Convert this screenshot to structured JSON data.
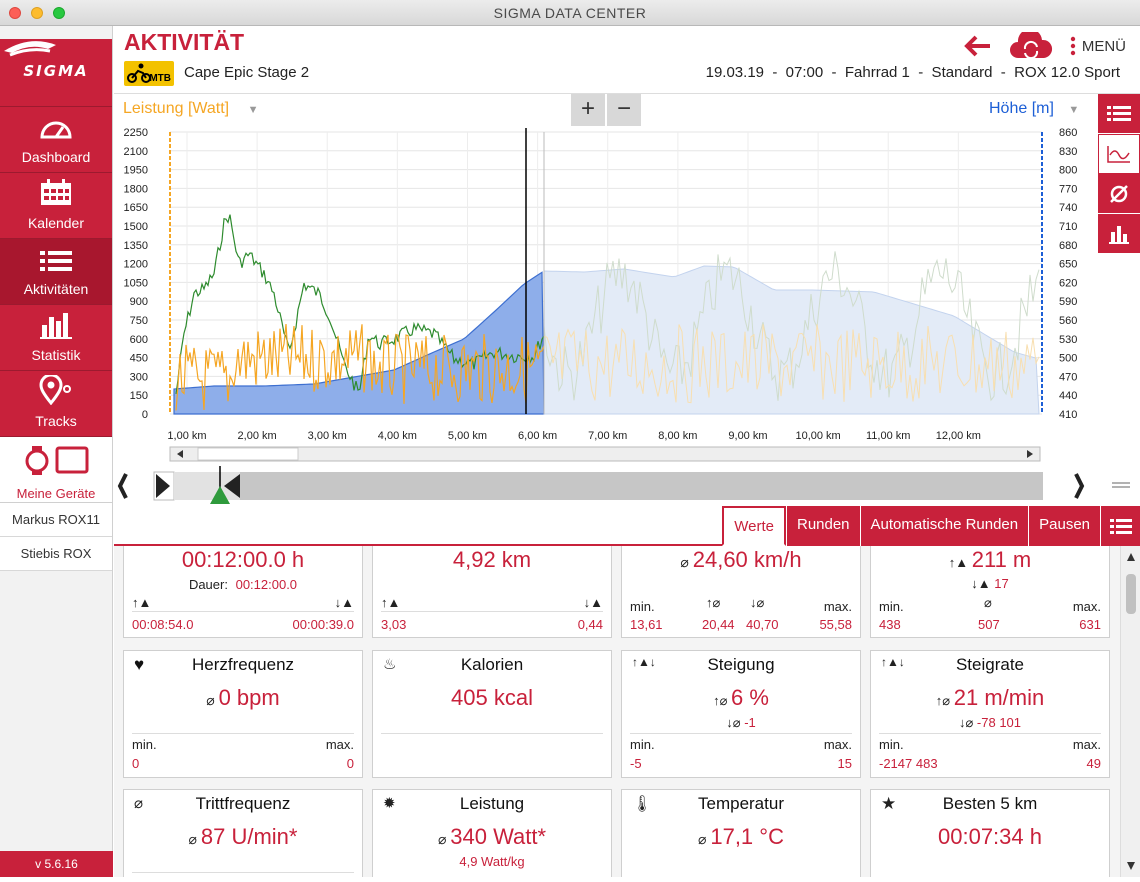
{
  "window": {
    "title": "SIGMA DATA CENTER"
  },
  "sidebar": {
    "brand": "SIGMA",
    "items": [
      {
        "label": "Dashboard",
        "icon": "speedometer-icon"
      },
      {
        "label": "Kalender",
        "icon": "calendar-icon"
      },
      {
        "label": "Aktivitäten",
        "icon": "list-icon"
      },
      {
        "label": "Statistik",
        "icon": "bar-chart-icon"
      },
      {
        "label": "Tracks",
        "icon": "map-pin-icon"
      }
    ],
    "devices_label": "Meine Geräte",
    "devices": [
      "Markus ROX11",
      "Stiebis ROX"
    ],
    "version": "v 5.6.16"
  },
  "header": {
    "title": "AKTIVITÄT",
    "sport_badge": "MTB",
    "activity_name": "Cape Epic Stage 2",
    "meta": "19.03.19  -  07:00  -  Fahrrad 1  -  Standard  -  ROX 12.0 Sport",
    "menu_label": "MENÜ"
  },
  "chart": {
    "left_axis_label": "Leistung [Watt]",
    "right_axis_label": "Höhe [m]",
    "zoom_in": "+",
    "zoom_out": "−",
    "left_ticks": [
      "2250",
      "2100",
      "1950",
      "1800",
      "1650",
      "1500",
      "1350",
      "1200",
      "1050",
      "900",
      "750",
      "600",
      "450",
      "300",
      "150",
      "0"
    ],
    "right_ticks": [
      "860",
      "830",
      "800",
      "770",
      "740",
      "710",
      "680",
      "650",
      "620",
      "590",
      "560",
      "530",
      "500",
      "470",
      "440",
      "410"
    ],
    "x_ticks": [
      "1,00 km",
      "2,00 km",
      "3,00 km",
      "4,00 km",
      "5,00 km",
      "6,00 km",
      "7,00 km",
      "8,00 km",
      "9,00 km",
      "10,00 km",
      "11,00 km",
      "12,00 km"
    ],
    "colors": {
      "power": "#f5a623",
      "heart": "#2e8b2e",
      "altitude": "#5a86e0",
      "left_axis": "#f5a623",
      "right_axis": "#1d5fd6"
    }
  },
  "tabs": [
    "Werte",
    "Runden",
    "Automatische Runden",
    "Pausen"
  ],
  "cards": [
    {
      "id": "dauer",
      "big": "00:12:00.0 h",
      "sub_label": "Dauer:",
      "sub_value": "00:12:00.0",
      "left": "00:08:54.0",
      "right": "00:00:39.0"
    },
    {
      "id": "distanz",
      "big": "4,92 km",
      "left": "3,03",
      "right": "0,44"
    },
    {
      "id": "geschwindigkeit",
      "big": "24,60 km/h",
      "min_label": "min.",
      "max_label": "max.",
      "vals": [
        "13,61",
        "20,44",
        "40,70",
        "55,58"
      ]
    },
    {
      "id": "hoehe",
      "big": "211 m",
      "sub_value": "17",
      "min_label": "min.",
      "max_label": "max.",
      "vals": [
        "438",
        "507",
        "631"
      ]
    },
    {
      "id": "herz",
      "title": "Herzfrequenz",
      "big": "0 bpm",
      "min_label": "min.",
      "max_label": "max.",
      "min": "0",
      "max": "0"
    },
    {
      "id": "kalorien",
      "title": "Kalorien",
      "big": "405 kcal"
    },
    {
      "id": "steigung",
      "title": "Steigung",
      "big": "6 %",
      "sub_value": "-1",
      "min_label": "min.",
      "max_label": "max.",
      "min": "-5",
      "max": "15"
    },
    {
      "id": "steigrate",
      "title": "Steigrate",
      "big": "21 m/min",
      "sub_value": "-78 101",
      "min_label": "min.",
      "max_label": "max.",
      "min": "-2147 483",
      "max": "49"
    },
    {
      "id": "tritt",
      "title": "Trittfrequenz",
      "big": "87 U/min*"
    },
    {
      "id": "leistung",
      "title": "Leistung",
      "big": "340 Watt*",
      "sub_value": "4,9 Watt/kg"
    },
    {
      "id": "temperatur",
      "title": "Temperatur",
      "big": "17,1 °C"
    },
    {
      "id": "besten",
      "title": "Besten 5 km",
      "big": "00:07:34 h"
    }
  ]
}
